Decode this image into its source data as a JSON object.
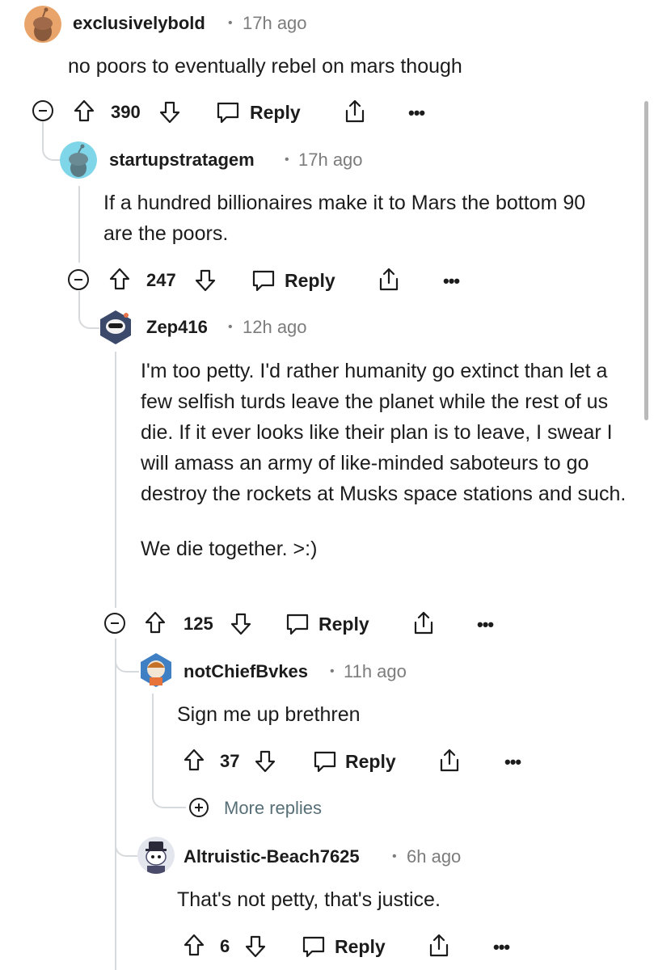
{
  "comments": [
    {
      "username": "exclusivelybold",
      "time": "17h ago",
      "body": [
        "no poors to eventually rebel on mars though"
      ],
      "score": "390",
      "reply_label": "Reply",
      "avatar_color": "#e8a46a"
    },
    {
      "username": "startupstratagem",
      "time": "17h ago",
      "body": [
        "If a hundred billionaires make it to Mars the bottom 90 are the poors."
      ],
      "score": "247",
      "reply_label": "Reply",
      "avatar_color": "#7fd6e8"
    },
    {
      "username": "Zep416",
      "time": "12h ago",
      "body": [
        "I'm too petty. I'd rather humanity go extinct than let a few selfish turds leave the planet while the rest of us die. If it ever looks like their plan is to leave, I swear I will amass an army of like-minded saboteurs to go destroy the rockets at Musks space stations and such.",
        "We die together. >:)"
      ],
      "score": "125",
      "reply_label": "Reply",
      "avatar_color": "#3b4a6b"
    },
    {
      "username": "notChiefBvkes",
      "time": "11h ago",
      "body": [
        "Sign me up brethren"
      ],
      "score": "37",
      "reply_label": "Reply",
      "avatar_color": "#3f7fc4"
    },
    {
      "username": "Altruistic-Beach7625",
      "time": "6h ago",
      "body": [
        "That's not petty, that's justice."
      ],
      "score": "6",
      "reply_label": "Reply",
      "avatar_color": "#4a4a6a"
    }
  ],
  "more_replies_label": "More replies",
  "separator": "•",
  "more_label": "•••",
  "colors": {
    "text": "#1c1c1c",
    "meta": "#7c7c7c",
    "thread_line": "#d7dadc",
    "more_replies": "#576f76"
  }
}
